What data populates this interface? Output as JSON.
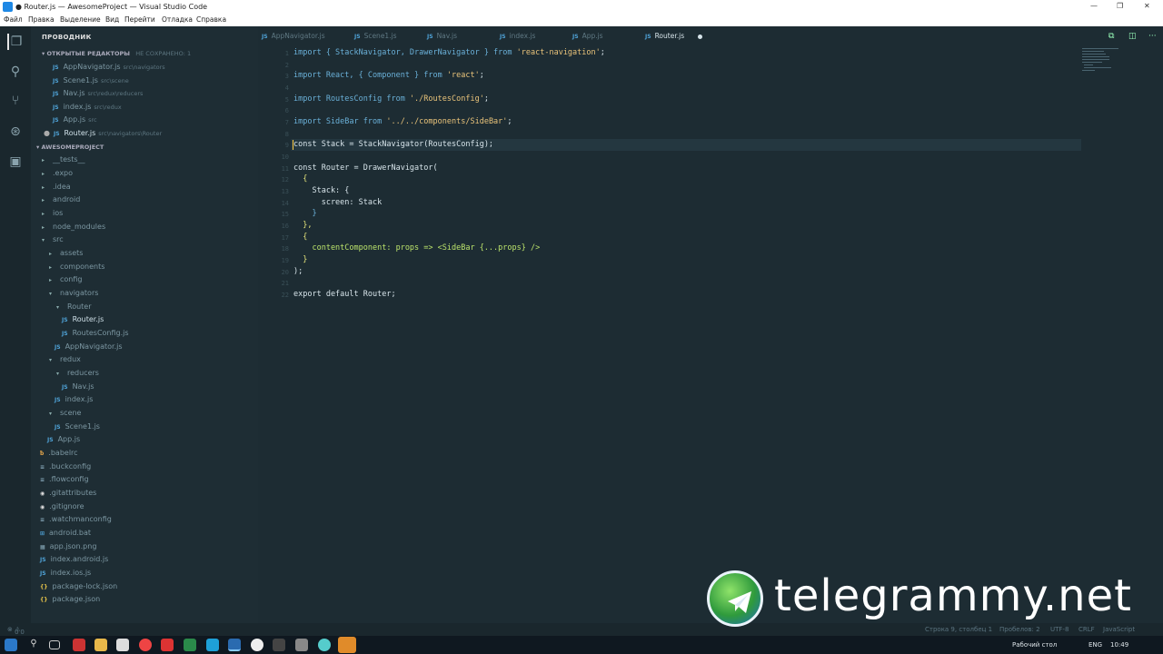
{
  "window": {
    "title": "● Router.js — AwesomeProject — Visual Studio Code"
  },
  "menu": [
    "Файл",
    "Правка",
    "Выделение",
    "Вид",
    "Перейти",
    "Отладка",
    "Справка"
  ],
  "sidebar": {
    "header": "ПРОВОДНИК",
    "open_editors": "ОТКРЫТЫЕ РЕДАКТОРЫ",
    "unsaved": "НЕ СОХРАНЕНО: 1",
    "project": "AWESOMEPROJECT",
    "open": [
      {
        "label": "AppNavigator.js",
        "desc": "src\\navigators"
      },
      {
        "label": "Scene1.js",
        "desc": "src\\scene"
      },
      {
        "label": "Nav.js",
        "desc": "src\\redux\\reducers"
      },
      {
        "label": "index.js",
        "desc": "src\\redux"
      },
      {
        "label": "App.js",
        "desc": "src"
      },
      {
        "label": "Router.js",
        "desc": "src\\navigators\\Router"
      }
    ],
    "tree": [
      "__tests__",
      ".expo",
      ".idea",
      "android",
      "ios",
      "node_modules",
      "src",
      "assets",
      "components",
      "config",
      "navigators",
      "Router",
      "Router.js",
      "RoutesConfig.js",
      "AppNavigator.js",
      "redux",
      "reducers",
      "Nav.js",
      "index.js",
      "scene",
      "Scene1.js",
      "App.js",
      ".babelrc",
      ".buckconfig",
      ".flowconfig",
      ".gitattributes",
      ".gitignore",
      ".watchmanconfig",
      "android.bat",
      "app.json.png",
      "index.android.js",
      "index.ios.js",
      "package-lock.json",
      "package.json"
    ]
  },
  "tabs": [
    "AppNavigator.js",
    "Scene1.js",
    "Nav.js",
    "index.js",
    "App.js",
    "Router.js"
  ],
  "code": {
    "l1": [
      "import { StackNavigator, DrawerNavigator } from ",
      "'react-navigation'",
      ";"
    ],
    "l3": [
      "import React, { Component } from ",
      "'react'",
      ";"
    ],
    "l5": [
      "import RoutesConfig from ",
      "'./RoutesConfig'",
      ";"
    ],
    "l7": [
      "import SideBar from ",
      "'../../components/SideBar'",
      ";"
    ],
    "l9": "const Stack = StackNavigator(RoutesConfig);",
    "l11": "const Router = DrawerNavigator(",
    "l12": "  {",
    "l13": "    Stack: {",
    "l14": "      screen: Stack",
    "l15": "    }",
    "l16": "  },",
    "l17": "  {",
    "l18": "    contentComponent: props => <SideBar {...props} />",
    "l19": "  }",
    "l20": ");",
    "l22": "export default Router;"
  },
  "status": {
    "errors": "0",
    "warnings": "0",
    "position": "Строка 9, столбец 1",
    "spaces": "Пробелов: 2",
    "encoding": "UTF-8",
    "eol": "CRLF",
    "lang": "JavaScript"
  },
  "taskbar": {
    "desktop": "Рабочий стол",
    "lang": "ENG",
    "time": "10:49"
  },
  "watermark": "telegrammy.net"
}
